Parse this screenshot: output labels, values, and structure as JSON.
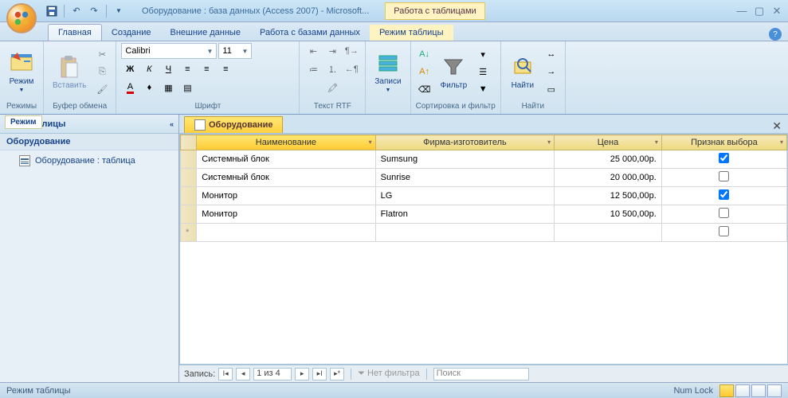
{
  "titlebar": {
    "title": "Оборудование : база данных (Access 2007) - Microsoft...",
    "context_tab": "Работа с таблицами"
  },
  "ribbon_tabs": [
    "Главная",
    "Создание",
    "Внешние данные",
    "Работа с базами данных",
    "Режим таблицы"
  ],
  "ribbon": {
    "view_label": "Режим",
    "view_group": "Режимы",
    "view_tooltip": "Режим",
    "paste_label": "Вставить",
    "clipboard_group": "Буфер обмена",
    "font_name": "Calibri",
    "font_size": "11",
    "font_group": "Шрифт",
    "rtf_group": "Текст RTF",
    "records_label": "Записи",
    "filter_label": "Фильтр",
    "sortfilter_group": "Сортировка и фильтр",
    "find_label": "Найти",
    "find_group": "Найти"
  },
  "nav": {
    "header_tip": "Режим",
    "header": "лицы",
    "section": "Оборудование",
    "items": [
      "Оборудование : таблица"
    ]
  },
  "doc": {
    "tab": "Оборудование"
  },
  "grid": {
    "columns": [
      "Наименование",
      "Фирма-изготовитель",
      "Цена",
      "Признак выбора"
    ],
    "rows": [
      {
        "name": "Системный блок",
        "firm": "Sumsung",
        "price": "25 000,00р.",
        "sel": true
      },
      {
        "name": "Системный блок",
        "firm": "Sunrise",
        "price": "20 000,00р.",
        "sel": false
      },
      {
        "name": "Монитор",
        "firm": "LG",
        "price": "12 500,00р.",
        "sel": true
      },
      {
        "name": "Монитор",
        "firm": "Flatron",
        "price": "10 500,00р.",
        "sel": false
      }
    ]
  },
  "recnav": {
    "label": "Запись:",
    "pos": "1 из 4",
    "nofilter": "Нет фильтра",
    "search": "Поиск"
  },
  "status": {
    "mode": "Режим таблицы",
    "numlock": "Num Lock"
  }
}
